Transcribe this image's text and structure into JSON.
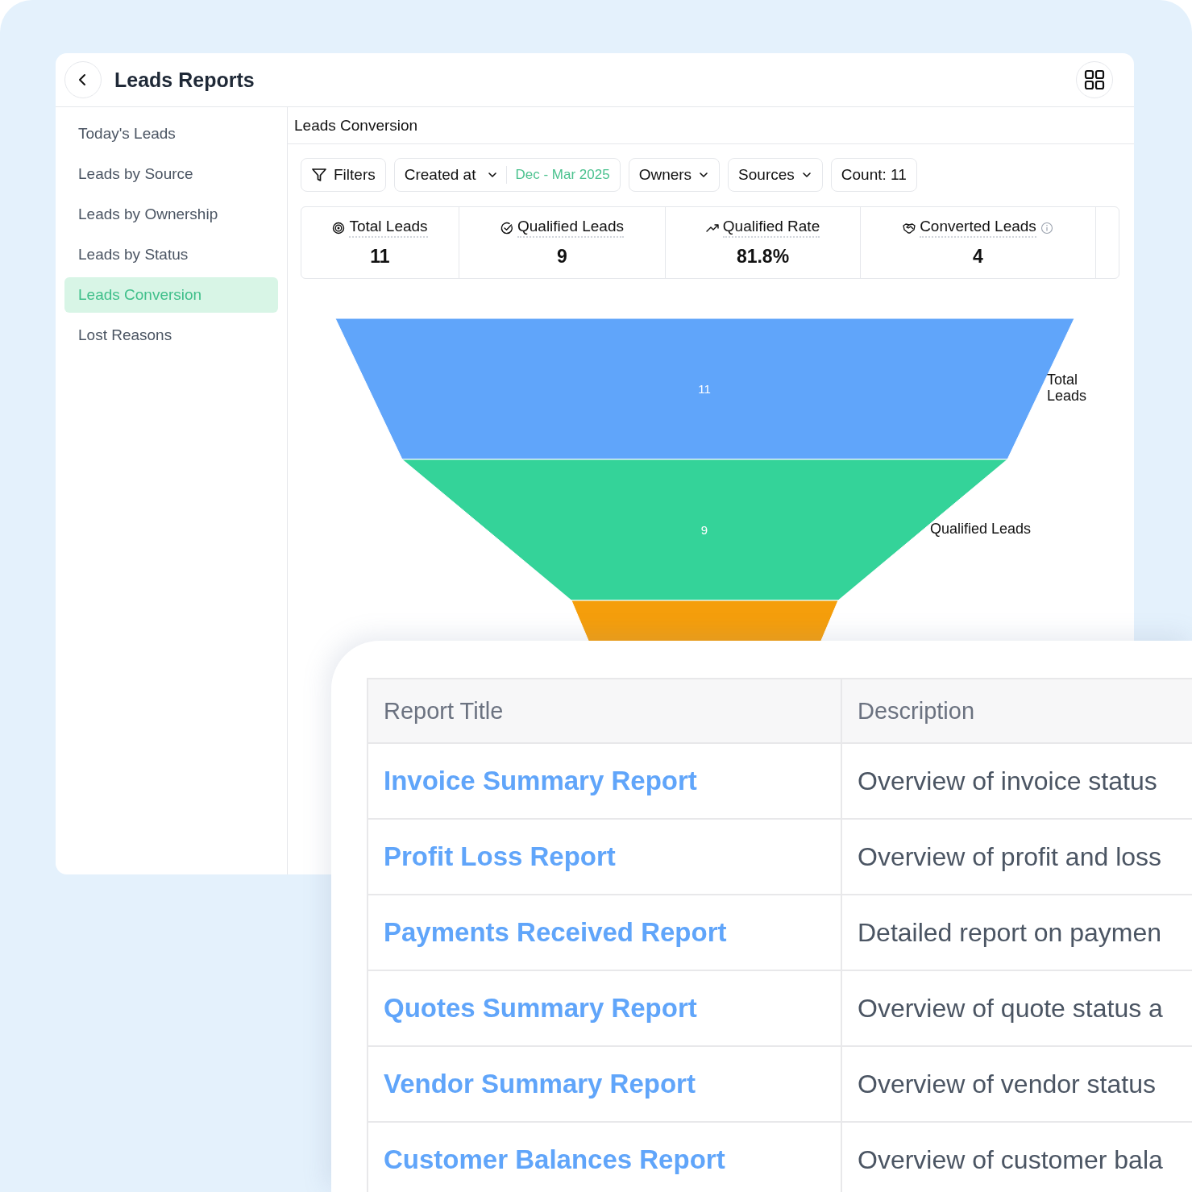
{
  "header": {
    "title": "Leads Reports"
  },
  "sidebar": {
    "items": [
      {
        "label": "Today's Leads",
        "selected": false
      },
      {
        "label": "Leads by Source",
        "selected": false
      },
      {
        "label": "Leads by Ownership",
        "selected": false
      },
      {
        "label": "Leads by Status",
        "selected": false
      },
      {
        "label": "Leads Conversion",
        "selected": true
      },
      {
        "label": "Lost Reasons",
        "selected": false
      }
    ]
  },
  "panel": {
    "title": "Leads Conversion"
  },
  "filters": [
    {
      "kind": "button",
      "label": "Filters"
    },
    {
      "kind": "date",
      "label": "Created at",
      "value": "Dec - Mar 2025"
    },
    {
      "kind": "dropdown",
      "label": "Owners"
    },
    {
      "kind": "dropdown",
      "label": "Sources"
    },
    {
      "kind": "count",
      "label": "Count: 11"
    }
  ],
  "stats": [
    {
      "label": "Total Leads",
      "value": "11",
      "info": false
    },
    {
      "label": "Qualified Leads",
      "value": "9",
      "info": false
    },
    {
      "label": "Qualified Rate",
      "value": "81.8%",
      "info": false
    },
    {
      "label": "Converted Leads",
      "value": "4",
      "info": true
    }
  ],
  "funnel": {
    "stages": [
      {
        "label": "Total Leads",
        "value": "11",
        "color": "#60a5fa"
      },
      {
        "label": "Qualified Leads",
        "value": "9",
        "color": "#34d399"
      },
      {
        "color": "#f59e0b"
      }
    ]
  },
  "reports": {
    "columns": [
      "Report Title",
      "Description"
    ],
    "rows": [
      {
        "title": "Invoice Summary Report",
        "description": "Overview of invoice status"
      },
      {
        "title": "Profit Loss Report",
        "description": "Overview of profit and loss"
      },
      {
        "title": "Payments Received Report",
        "description": "Detailed report on paymen"
      },
      {
        "title": "Quotes Summary Report",
        "description": "Overview of quote status a"
      },
      {
        "title": "Vendor Summary Report",
        "description": "Overview of vendor status"
      },
      {
        "title": "Customer Balances Report",
        "description": "Overview of customer bala"
      }
    ]
  }
}
